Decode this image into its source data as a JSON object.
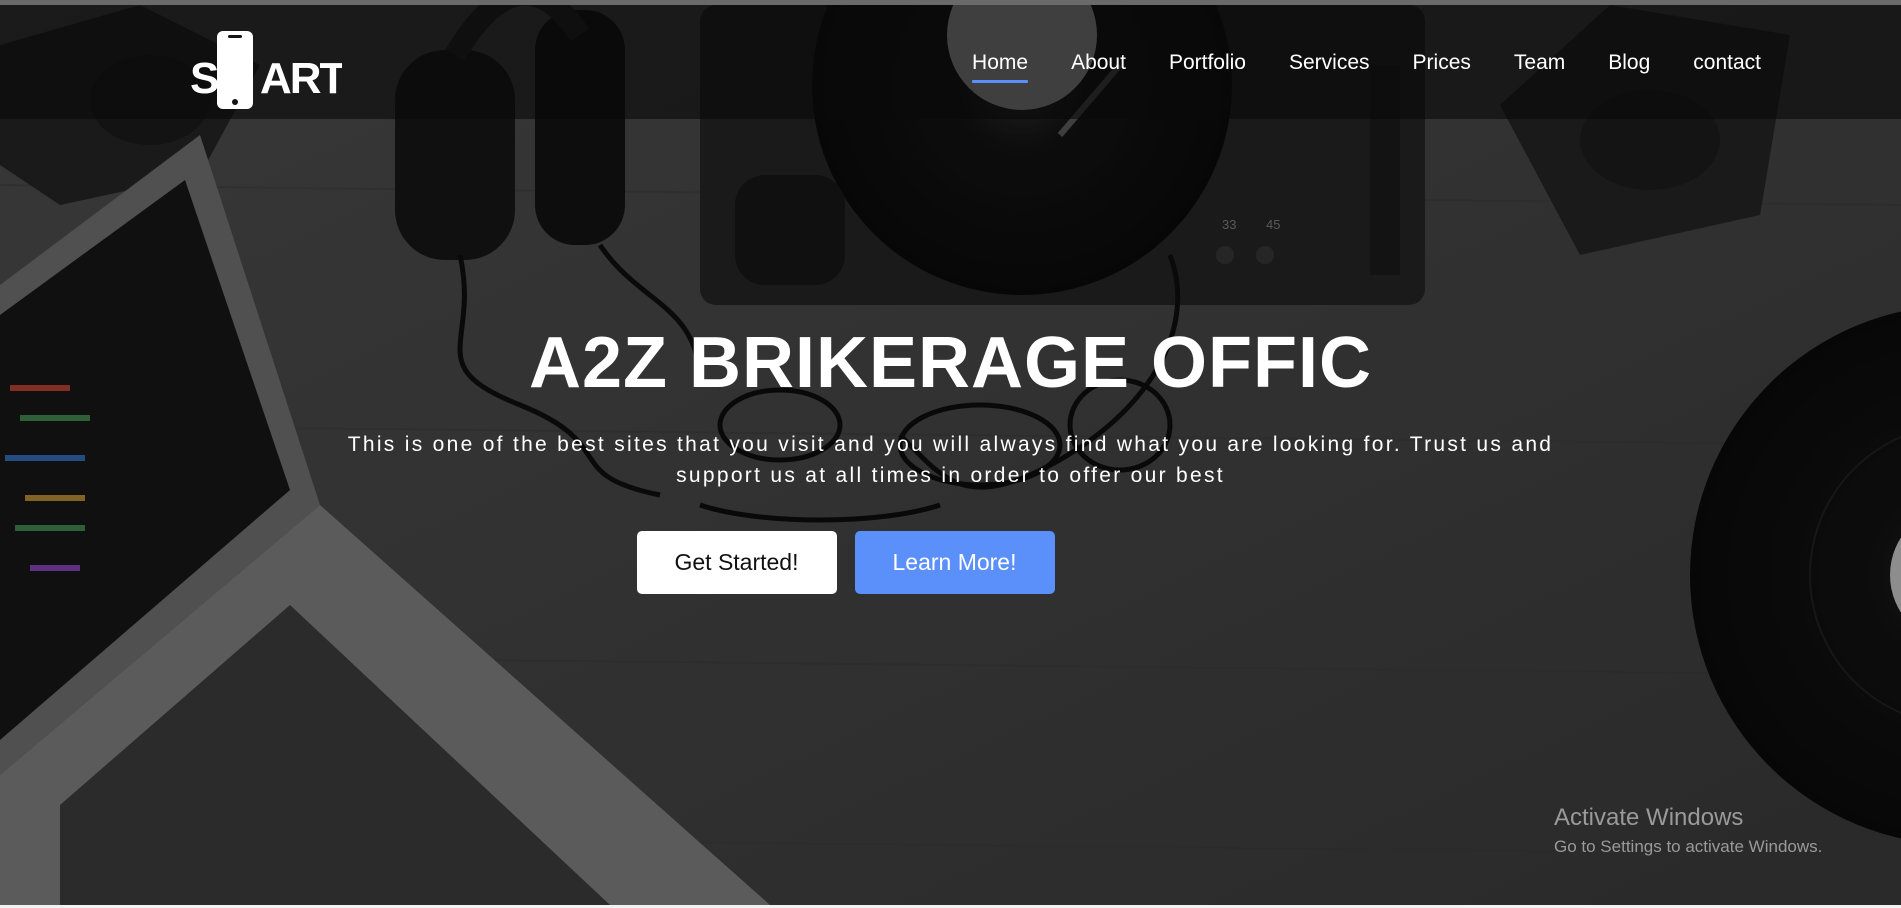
{
  "brand": {
    "logo_text": "SmART",
    "logo_text_left": "S",
    "logo_text_right": "ART"
  },
  "nav": {
    "items": [
      {
        "label": "Home",
        "active": true
      },
      {
        "label": "About",
        "active": false
      },
      {
        "label": "Portfolio",
        "active": false
      },
      {
        "label": "Services",
        "active": false
      },
      {
        "label": "Prices",
        "active": false
      },
      {
        "label": "Team",
        "active": false
      },
      {
        "label": "Blog",
        "active": false
      },
      {
        "label": "contact",
        "active": false
      }
    ],
    "active_color": "#5b8ff9"
  },
  "hero": {
    "title": "A2Z BRIKERAGE OFFIC",
    "text": "This is one of the best sites that you visit and you will always find what you are looking for. Trust us and support us at all times in order to offer our best",
    "primary_button": "Get Started!",
    "secondary_button": "Learn More!"
  },
  "watermark": {
    "title": "Activate Windows",
    "subtitle": "Go to Settings to activate Windows."
  },
  "background": {
    "subject": "laptop, headphones, turntable, speakers, vinyl record on desk",
    "labels": {
      "rpm_33": "33",
      "rpm_45": "45"
    }
  },
  "colors": {
    "accent": "#5b8ff9",
    "nav_bg": "#141414",
    "hero_bg": "#3e3e3e"
  }
}
